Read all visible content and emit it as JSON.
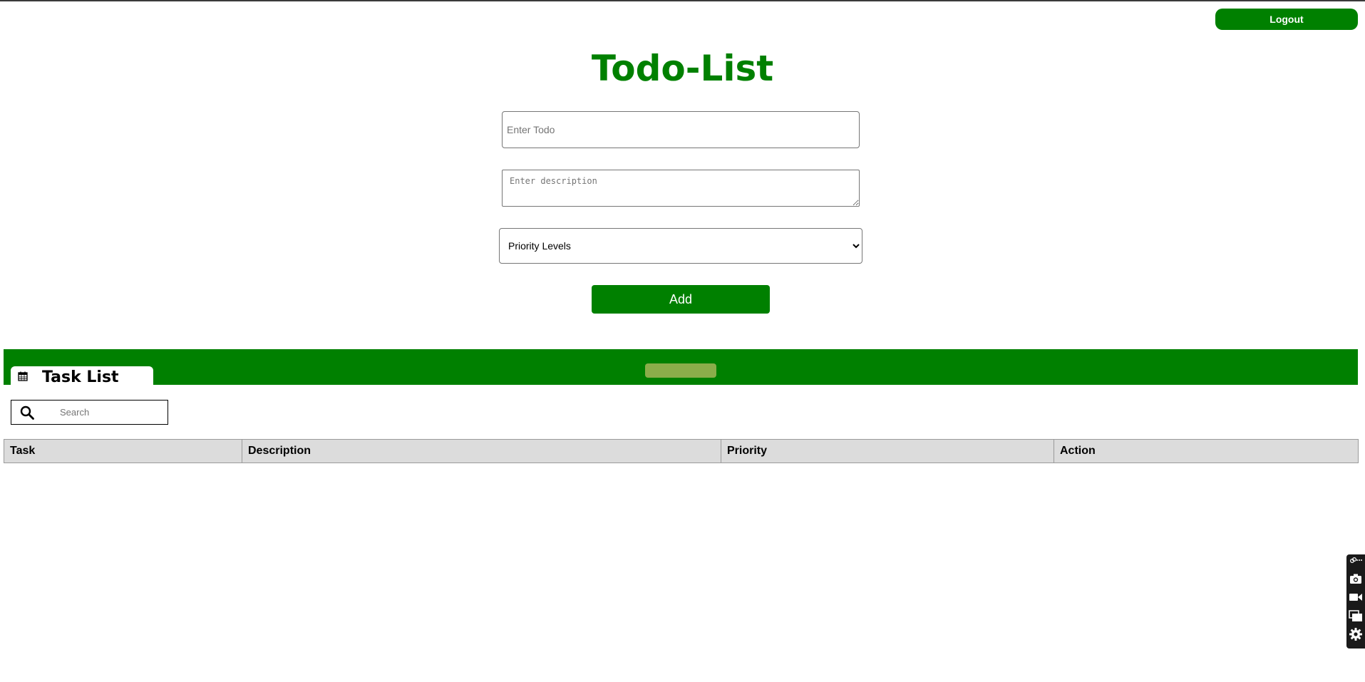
{
  "header": {
    "logout_label": "Logout",
    "title": "Todo-List"
  },
  "form": {
    "todo_placeholder": "Enter Todo",
    "description_placeholder": "Enter description",
    "priority_selected": "Priority Levels",
    "add_label": "Add"
  },
  "task_section": {
    "tab_icon": "calendar-icon",
    "tab_label": "Task List",
    "search_icon": "search-icon",
    "search_placeholder": "Search"
  },
  "table": {
    "columns": [
      "Task",
      "Description",
      "Priority",
      "Action"
    ],
    "rows": []
  },
  "toolbar": {
    "icons": [
      "link-more-icon",
      "camera-icon",
      "video-icon",
      "screens-icon",
      "gear-icon"
    ]
  },
  "colors": {
    "accent": "#008000",
    "handle": "#8bad4a",
    "table_header_bg": "#dcdcdc"
  }
}
